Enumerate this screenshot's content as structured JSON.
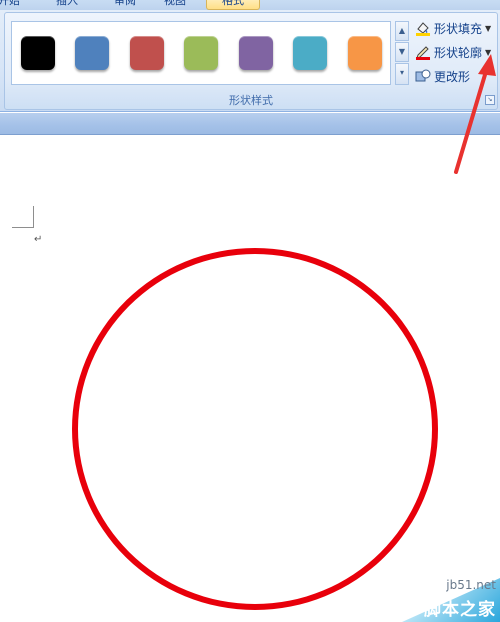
{
  "ribbon": {
    "tabs": [
      {
        "label": "开始",
        "active": false
      },
      {
        "label": "插入",
        "active": false
      },
      {
        "label": "审阅",
        "active": false
      },
      {
        "label": "视图",
        "active": false
      },
      {
        "label": "格式",
        "active": true
      }
    ],
    "shape_styles": {
      "group_label": "形状样式",
      "swatches": [
        {
          "name": "black",
          "color": "#000000"
        },
        {
          "name": "blue",
          "color": "#4f81bd"
        },
        {
          "name": "red",
          "color": "#c0504d"
        },
        {
          "name": "green",
          "color": "#9bbb59"
        },
        {
          "name": "purple",
          "color": "#8064a2"
        },
        {
          "name": "aqua",
          "color": "#4bacc6"
        },
        {
          "name": "orange",
          "color": "#f79646"
        }
      ],
      "commands": {
        "fill": "形状填充",
        "outline": "形状轮廓",
        "change": "更改形"
      }
    }
  },
  "document": {
    "shape": {
      "type": "circle",
      "outline_color": "#e8000b",
      "fill": "none"
    },
    "paragraph_mark": "↵"
  },
  "watermark": {
    "url": "jb51.net",
    "name": "脚本之家"
  },
  "annotation": {
    "arrow_color": "#e8322f"
  }
}
